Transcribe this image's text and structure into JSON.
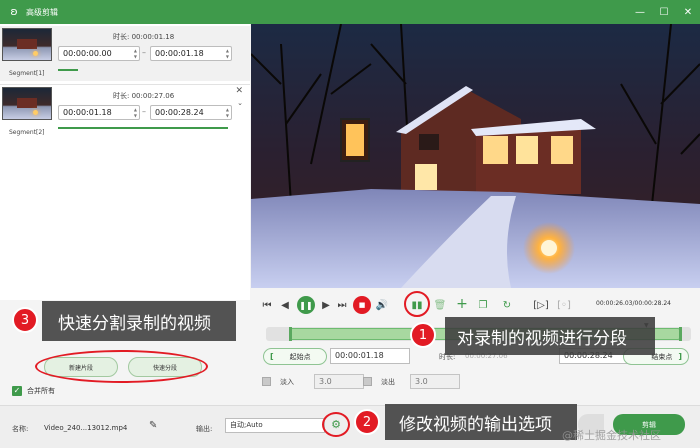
{
  "window": {
    "title": "高级剪辑",
    "logo_icon": "rabbit-logo-icon",
    "controls": [
      "—",
      "☐",
      "✕"
    ]
  },
  "segments": [
    {
      "label": "Segment[1]",
      "duration_label": "时长:",
      "duration": "00:00:01.18",
      "start": "00:00:00.00",
      "end": "00:00:01.18"
    },
    {
      "label": "Segment[2]",
      "duration_label": "时长:",
      "duration": "00:00:27.06",
      "start": "00:00:01.18",
      "end": "00:00:28.24"
    }
  ],
  "player": {
    "time_readout": "00:00:26.03/00:00:28.24"
  },
  "range": {
    "start_label": "起始点",
    "start_value": "00:00:01.18",
    "duration_label": "时长:",
    "duration_value": "00:00:27.06",
    "end_value": "00:00:28.24",
    "end_label": "结束点"
  },
  "fade": {
    "fade_in_label": "淡入",
    "fade_in_value": "3.0",
    "fade_out_label": "淡出",
    "fade_out_value": "3.0"
  },
  "left_actions": {
    "new_segment": "新建片段",
    "quick_split": "快速分段",
    "merge_all": "合并所有"
  },
  "bottom": {
    "name_label": "名称:",
    "name_value": "Video_240...13012.mp4",
    "output_label": "输出:",
    "output_value": "自动;Auto",
    "cut_button": "剪辑"
  },
  "callouts": [
    {
      "number": "1",
      "text": "对录制的视频进行分段"
    },
    {
      "number": "2",
      "text": "修改视频的输出选项"
    },
    {
      "number": "3",
      "text": "快速分割录制的视频"
    }
  ],
  "watermark": "@稀土掘金技术社区",
  "colors": {
    "brand_green": "#3f9a4b",
    "highlight_red": "#e21b24"
  }
}
